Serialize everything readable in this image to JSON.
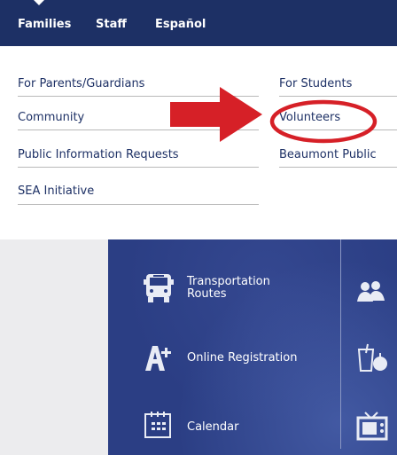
{
  "nav": {
    "items": [
      {
        "label": "Families"
      },
      {
        "label": "Staff"
      },
      {
        "label": "Español"
      }
    ]
  },
  "dropdown": {
    "left_column": [
      {
        "label": "For Parents/Guardians"
      },
      {
        "label": "Community"
      },
      {
        "label": "Public Information Requests"
      },
      {
        "label": "SEA Initiative"
      }
    ],
    "right_column": [
      {
        "label": "For Students"
      },
      {
        "label": "Volunteers"
      },
      {
        "label": "Beaumont Public"
      }
    ]
  },
  "annotation": {
    "arrow_color": "#d62027",
    "highlight_color": "#d62027"
  },
  "tiles": {
    "transportation": {
      "line1": "Transportation",
      "line2": "Routes",
      "icon": "bus-icon"
    },
    "registration": {
      "label": "Online Registration",
      "icon": "a-plus-icon"
    },
    "calendar": {
      "label": "Calendar",
      "icon": "calendar-icon"
    },
    "right_icons": [
      "people-icon",
      "cup-apple-icon",
      "tv-icon"
    ]
  },
  "colors": {
    "nav_bg": "#1d3065",
    "link": "#1d3065",
    "panel_bg": "#2b3e84"
  }
}
